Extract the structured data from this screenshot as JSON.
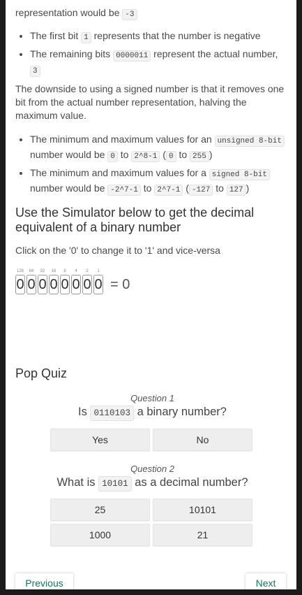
{
  "intro": {
    "line0_text": "representation would be",
    "line0_code": "-3"
  },
  "bullets1": [
    {
      "pre": "The first bit",
      "code": "1",
      "post": "represents that the number is negative"
    },
    {
      "pre": "The remaining bits",
      "code": "0000011",
      "post": "represent the actual number,",
      "code2": "3"
    }
  ],
  "downside": "The downside to using a signed number is that it removes one bit from the actual number representation, halving the maximum value.",
  "bullets2": {
    "a_pre": "The minimum and maximum values for an",
    "a_code1": "unsigned 8-bit",
    "a_mid": "number would be",
    "a_code2": "0",
    "a_to": "to",
    "a_code3": "2^8-1",
    "a_code4": "0",
    "a_to2": "to",
    "a_code5": "255",
    "b_pre": "The minimum and maximum values for a",
    "b_code1": "signed 8-bit",
    "b_mid": "number would be",
    "b_code2": "-2^7-1",
    "b_to": "to",
    "b_code3": "2^7-1",
    "b_code4": "-127",
    "b_to2": "to",
    "b_code5": "127"
  },
  "simulator": {
    "heading": "Use the Simulator below to get the decimal equivalent of a binary number",
    "instruction": "Click on the '0' to change it to '1' and vice-versa",
    "weights": [
      "128",
      "64",
      "32",
      "16",
      "8",
      "4",
      "2",
      "1"
    ],
    "bits": [
      "0",
      "0",
      "0",
      "0",
      "0",
      "0",
      "0",
      "0"
    ],
    "result": "= 0"
  },
  "quiz": {
    "heading": "Pop Quiz",
    "q1": {
      "num": "Question 1",
      "pre": "Is",
      "code": "0110103",
      "post": "a binary number?",
      "answers": [
        "Yes",
        "No"
      ]
    },
    "q2": {
      "num": "Question 2",
      "pre": "What is",
      "code": "10101",
      "post": "as a decimal number?",
      "answers": [
        "25",
        "10101",
        "1000",
        "21"
      ]
    }
  },
  "nav": {
    "previous": "Previous",
    "next": "Next"
  }
}
